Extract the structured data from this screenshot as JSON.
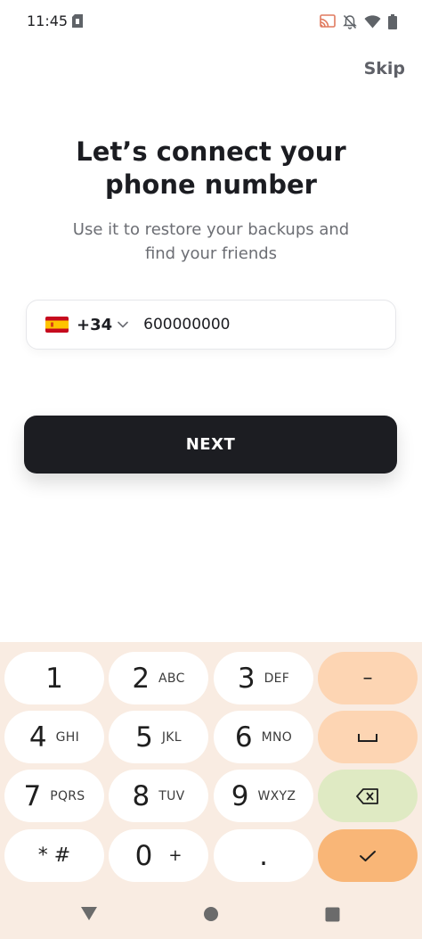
{
  "status_bar": {
    "time": "11:45",
    "icons": [
      "sim-card-icon",
      "cast-icon",
      "bell-off-icon",
      "wifi-icon",
      "battery-icon"
    ]
  },
  "header": {
    "skip_label": "Skip"
  },
  "main": {
    "title_line1": "Let’s connect your",
    "title_line2": "phone number",
    "subtitle_line1": "Use it to restore your backups and",
    "subtitle_line2": "find your friends",
    "country_flag": "spain-flag-icon",
    "dial_code": "+34",
    "phone_value": "600000000",
    "next_label": "NEXT"
  },
  "keypad": {
    "keys": [
      {
        "num": "1",
        "letters": ""
      },
      {
        "num": "2",
        "letters": "ABC"
      },
      {
        "num": "3",
        "letters": "DEF"
      },
      {
        "num": "4",
        "letters": "GHI"
      },
      {
        "num": "5",
        "letters": "JKL"
      },
      {
        "num": "6",
        "letters": "MNO"
      },
      {
        "num": "7",
        "letters": "PQRS"
      },
      {
        "num": "8",
        "letters": "TUV"
      },
      {
        "num": "9",
        "letters": "WXYZ"
      },
      {
        "num": "* #",
        "letters": ""
      },
      {
        "num": "0",
        "letters": "+"
      },
      {
        "num": ".",
        "letters": ""
      }
    ],
    "actions": {
      "dash": "–",
      "space": "space-icon",
      "backspace": "backspace-icon",
      "done": "check-icon"
    }
  },
  "colors": {
    "primary_button": "#1c1d22",
    "keypad_bg": "#f9ece2",
    "key_peach": "#fdd5b3",
    "key_green": "#dfeac3",
    "key_orange": "#f9b677"
  }
}
